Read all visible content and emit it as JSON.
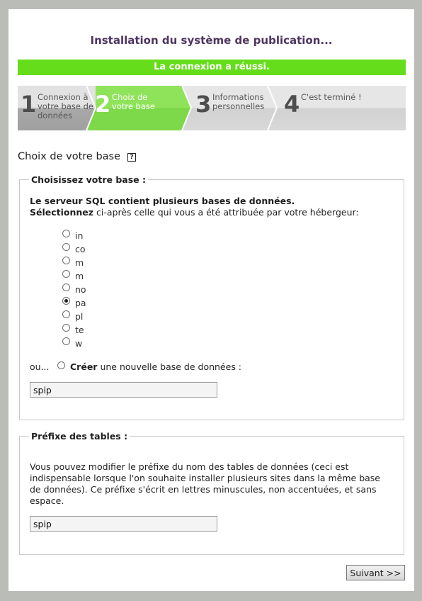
{
  "title": "Installation du système de publication...",
  "banner": "La connexion a réussi.",
  "steps": [
    {
      "num": "1",
      "label_lines": [
        "Connexion à",
        "votre base de",
        "données"
      ],
      "active": false
    },
    {
      "num": "2",
      "label_lines": [
        "Choix de",
        "votre base"
      ],
      "active": true
    },
    {
      "num": "3",
      "label_lines": [
        "Informations",
        "personnelles"
      ],
      "active": false
    },
    {
      "num": "4",
      "label_lines": [
        "C'est terminé !"
      ],
      "active": false
    }
  ],
  "section": {
    "title": "Choix de votre base",
    "help_icon": "help-icon"
  },
  "choose_base": {
    "legend": "Choisissez votre base :",
    "line1": "Le serveur SQL contient plusieurs bases de données.",
    "line2_bold": "Sélectionnez",
    "line2_rest": " ci-après celle qui vous a été attribuée par votre hébergeur:",
    "options": [
      {
        "label": "in",
        "checked": false
      },
      {
        "label": "co",
        "checked": false
      },
      {
        "label": "m",
        "checked": false
      },
      {
        "label": "m",
        "checked": false
      },
      {
        "label": "no",
        "checked": false
      },
      {
        "label": "pa",
        "checked": true
      },
      {
        "label": "pl",
        "checked": false
      },
      {
        "label": "te",
        "checked": false
      },
      {
        "label": "w",
        "checked": false
      }
    ],
    "or_prefix": "ou...",
    "create_bold": "Créer",
    "create_rest": " une nouvelle base de données :",
    "new_base_value": "spip"
  },
  "prefix": {
    "legend": "Préfixe des tables :",
    "description": "Vous pouvez modifier le préfixe du nom des tables de données (ceci est indispensable lorsque l'on souhaite installer plusieurs sites dans la même base de données). Ce préfixe s'écrit en lettres minuscules, non accentuées, et sans espace.",
    "value": "spip"
  },
  "next_button": "Suivant >>"
}
